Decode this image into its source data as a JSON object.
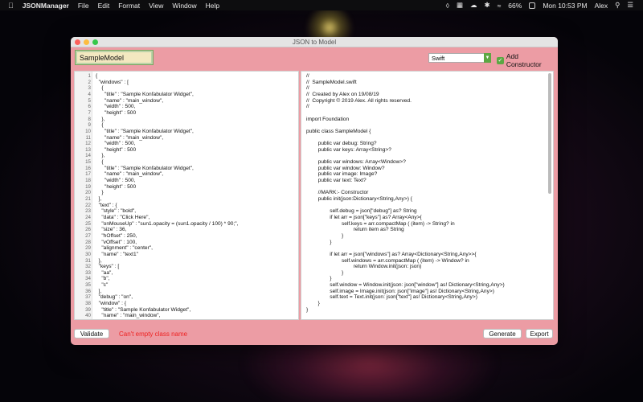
{
  "menubar": {
    "app_name": "JSONManager",
    "menus": [
      "File",
      "Edit",
      "Format",
      "View",
      "Window",
      "Help"
    ],
    "battery": "66%",
    "clock": "Mon 10:53 PM",
    "user": "Alex"
  },
  "window": {
    "title": "JSON to Model"
  },
  "toolbar": {
    "class_name_value": "SampleModel",
    "language_selected": "Swift",
    "add_constructor_label": "Add Constructor",
    "add_constructor_checked": true
  },
  "json_editor": {
    "lines": [
      "{",
      "  \"windows\" : [",
      "    {",
      "      \"title\" : \"Sample Konfabulator Widget\",",
      "      \"name\" : \"main_window\",",
      "      \"width\" : 500,",
      "      \"height\" : 500",
      "    },",
      "    {",
      "      \"title\" : \"Sample Konfabulator Widget\",",
      "      \"name\" : \"main_window\",",
      "      \"width\" : 500,",
      "      \"height\" : 500",
      "    },",
      "    {",
      "      \"title\" : \"Sample Konfabulator Widget\",",
      "      \"name\" : \"main_window\",",
      "      \"width\" : 500,",
      "      \"height\" : 500",
      "    }",
      "  ],",
      "  \"text\" : {",
      "    \"style\" : \"bold\",",
      "    \"data\" : \"Click Here\",",
      "    \"onMouseUp\" : \"sun1.opacity = (sun1.opacity / 100) * 90;\",",
      "    \"size\" : 36,",
      "    \"hOffset\" : 250,",
      "    \"vOffset\" : 100,",
      "    \"alignment\" : \"center\",",
      "    \"name\" : \"text1\"",
      "  },",
      "  \"keys\" : [",
      "    \"aa\",",
      "    \"b\",",
      "    \"c\"",
      "  ],",
      "  \"debug\" : \"on\",",
      "  \"window\" : {",
      "    \"title\" : \"Sample Konfabulator Widget\",",
      "    \"name\" : \"main_window\","
    ]
  },
  "swift_output": {
    "lines": [
      "//",
      "//  SampleModel.swift",
      "//",
      "//  Created by Alex on 19/08/19",
      "//  Copyright © 2019 Alex. All rights reserved.",
      "//",
      "",
      "import Foundation",
      "",
      "public class SampleModel {",
      "",
      "        public var debug: String?",
      "        public var keys: Array<String>?",
      "",
      "        public var windows: Array<Window>?",
      "        public var window: Window?",
      "        public var image: Image?",
      "        public var text: Text?",
      "",
      "        //MARK:- Constructor",
      "        public init(json:Dictionary<String,Any>) {",
      "",
      "                self.debug = json[\"debug\"] as? String",
      "                if let arr = json[\"keys\"] as? Array<Any>{",
      "                        self.keys = arr.compactMap ( (item) -> String? in",
      "                                return item as? String",
      "                        }",
      "                }",
      "",
      "                if let arr = json[\"windows\"] as? Array<Dictionary<String,Any>>{",
      "                        self.windows = arr.compactMap ( (item) -> Window? in",
      "                                return Window.init(json: json)",
      "                        }",
      "                }",
      "                self.window = Window.init(json: json[\"window\"] as! Dictionary<String,Any>)",
      "                self.image = Image.init(json: json[\"image\"] as! Dictionary<String,Any>)",
      "                self.text = Text.init(json: json[\"text\"] as! Dictionary<String,Any>)",
      "        }",
      "}"
    ]
  },
  "bottombar": {
    "validate_label": "Validate",
    "error_message": "Can't empty class name",
    "generate_label": "Generate",
    "export_label": "Export"
  },
  "colors": {
    "window_bg": "#ec9ca4",
    "accent_green": "#5ca743",
    "error_red": "#ee2222"
  }
}
